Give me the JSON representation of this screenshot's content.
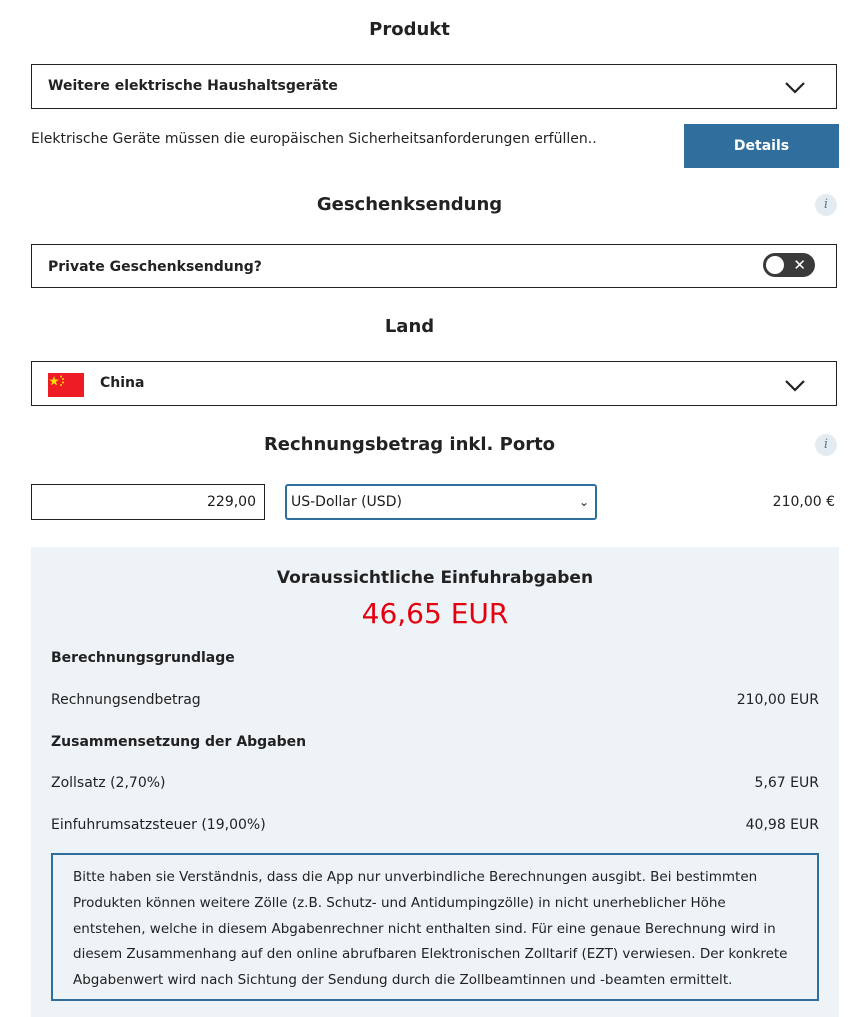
{
  "produkt": {
    "title": "Produkt",
    "selected": "Weitere elektrische Haushaltsgeräte",
    "hint": "Elektrische Geräte müssen die europäischen Sicherheitsanforderungen erfüllen..",
    "details_button": "Details"
  },
  "geschenk": {
    "title": "Geschenksendung",
    "info_icon": "i",
    "toggle_label": "Private Geschenksendung?",
    "toggle_state": "off"
  },
  "land": {
    "title": "Land",
    "selected": "China",
    "flag_icon": "china-flag"
  },
  "rechnung": {
    "title": "Rechnungsbetrag inkl. Porto",
    "info_icon": "i",
    "amount": "229,00",
    "currency": "US-Dollar (USD)",
    "converted": "210,00 €"
  },
  "result": {
    "title": "Voraussichtliche Einfuhrabgaben",
    "total": "46,65 EUR",
    "basis_heading": "Berechnungsgrundlage",
    "invoice_label": "Rechnungsendbetrag",
    "invoice_value": "210,00 EUR",
    "composition_heading": "Zusammensetzung der Abgaben",
    "duty_label": "Zollsatz (2,70%)",
    "duty_value": "5,67 EUR",
    "vat_label": "Einfuhrumsatzsteuer (19,00%)",
    "vat_value": "40,98 EUR",
    "disclaimer": "Bitte haben sie Verständnis, dass die App nur unverbindliche Berechnungen ausgibt. Bei bestimmten Produkten können weitere Zölle (z.B. Schutz- und Antidumpingzölle) in nicht unerheblicher Höhe entstehen, welche in diesem Abgabenrechner nicht enthalten sind. Für eine genaue Berechnung wird in diesem Zusammenhang auf den online abrufbaren Elektronischen Zolltarif (EZT) verwiesen. Der konkrete Abgabenwert wird nach Sichtung der Sendung durch die Zollbeamtinnen und -beamten ermittelt."
  },
  "colors": {
    "accent": "#2f6e9d",
    "total_red": "#e3000f",
    "panel_bg": "#eef3f7"
  }
}
